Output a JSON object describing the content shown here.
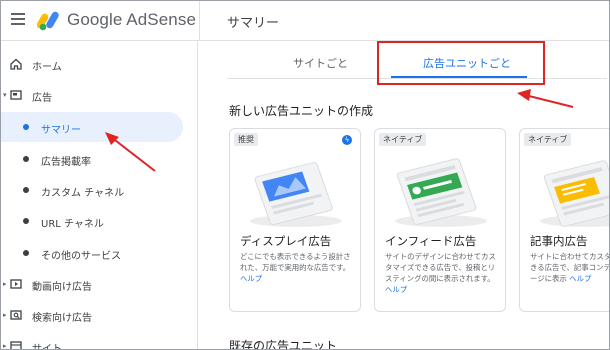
{
  "header": {
    "brand": "Google AdSense",
    "page_title": "サマリー"
  },
  "sidebar": {
    "items": [
      {
        "label": "ホーム"
      },
      {
        "label": "広告"
      },
      {
        "label": "サマリー"
      },
      {
        "label": "広告掲載率"
      },
      {
        "label": "カスタム チャネル"
      },
      {
        "label": "URL チャネル"
      },
      {
        "label": "その他のサービス"
      },
      {
        "label": "動画向け広告"
      },
      {
        "label": "検索向け広告"
      },
      {
        "label": "サイト"
      }
    ]
  },
  "tabs": [
    {
      "label": "サイトごと"
    },
    {
      "label": "広告ユニットごと"
    }
  ],
  "section_new": "新しい広告ユニットの作成",
  "section_existing": "既存の広告ユニット",
  "cards": [
    {
      "badge": "推奨",
      "title": "ディスプレイ広告",
      "desc": "どこにでも表示できるよう設計された、万能で実用的な広告です。",
      "help": "ヘルプ",
      "accent": "#4285f4"
    },
    {
      "badge": "ネイティブ",
      "title": "インフィード広告",
      "desc": "サイトのデザインに合わせてカスタマイズできる広告で、投稿とリスティングの間に表示されます。",
      "help": "ヘルプ",
      "accent": "#34a853"
    },
    {
      "badge": "ネイティブ",
      "title": "記事内広告",
      "desc": "サイトに合わせてカスタマイズできる広告で、記事コンテンツのページに表示",
      "help": "ヘルプ",
      "accent": "#fbbc04"
    }
  ],
  "colors": {
    "accent": "#1a73e8",
    "highlight": "#e02424"
  }
}
